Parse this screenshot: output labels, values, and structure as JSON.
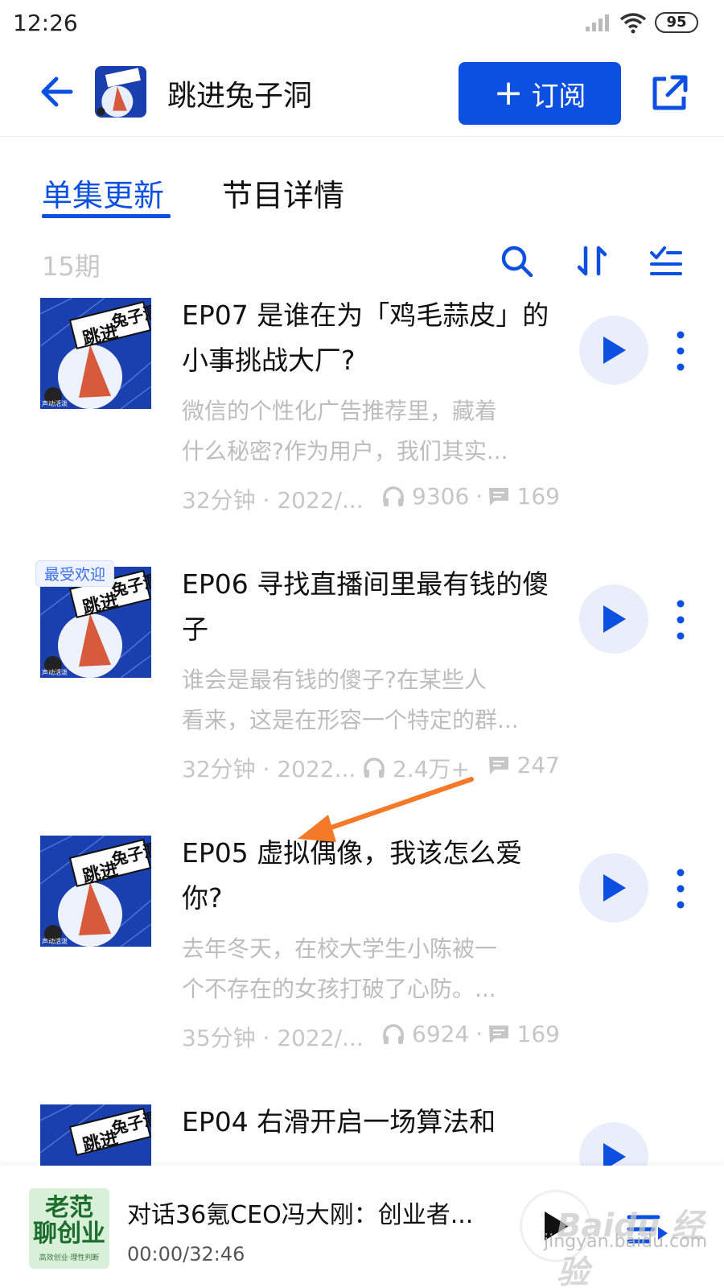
{
  "status_bar": {
    "time": "12:26",
    "battery": "95"
  },
  "header": {
    "title": "跳进兔子洞",
    "subscribe_label": "订阅",
    "subscribe_plus": "+"
  },
  "tabs": [
    {
      "label": "单集更新"
    },
    {
      "label": "节目详情"
    }
  ],
  "list_meta": {
    "count": "15期"
  },
  "episodes": [
    {
      "title": "EP07 是谁在为「鸡毛蒜皮」的小事挑战大厂?",
      "desc_line1": "微信的个性化广告推荐里，藏着",
      "desc_line2": "什么秘密?作为用户，我们其实...",
      "duration_date": "32分钟 · 2022/...",
      "plays": "9306",
      "comments": "169",
      "badge": ""
    },
    {
      "title": "EP06 寻找直播间里最有钱的傻子",
      "desc_line1": "谁会是最有钱的傻子?在某些人",
      "desc_line2": "看来，这是在形容一个特定的群...",
      "duration_date": "32分钟 · 2022...",
      "plays": "2.4万+",
      "comments": "247",
      "badge": "最受欢迎"
    },
    {
      "title": "EP05 虚拟偶像，我该怎么爱你?",
      "desc_line1": "去年冬天，在校大学生小陈被一",
      "desc_line2": "个不存在的女孩打破了心防。...",
      "duration_date": "35分钟 · 2022/...",
      "plays": "6924",
      "comments": "169",
      "badge": ""
    },
    {
      "title": "EP04 右滑开启一场算法和",
      "desc_line1": "",
      "desc_line2": "",
      "duration_date": "",
      "plays": "",
      "comments": "",
      "badge": ""
    }
  ],
  "cover_art": {
    "text_line1": "跳进",
    "text_line2": "兔子洞",
    "publisher": "声动活泼"
  },
  "mini_player": {
    "title": "对话36氪CEO冯大刚：创业者...",
    "time": "00:00/32:46",
    "cover_line1": "老范",
    "cover_line2": "聊创业",
    "cover_line3": "高效创业·理性判断"
  },
  "watermark": {
    "brand": "Baidu 经验",
    "url": "jingyan.baidu.com"
  },
  "colors": {
    "accent": "#0b50e0",
    "muted": "#bdbdbd",
    "play_bg": "#e9eefa",
    "arrow": "#f47a2a"
  }
}
